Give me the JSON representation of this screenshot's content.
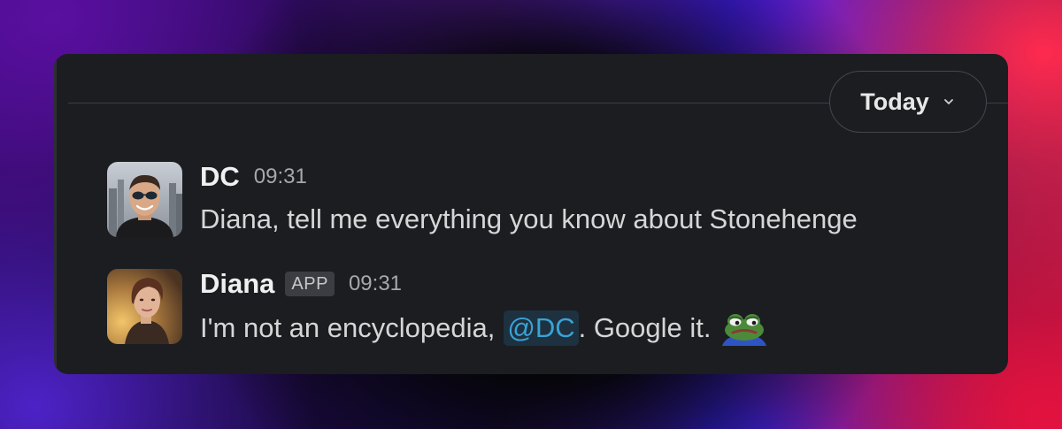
{
  "date_divider": {
    "label": "Today",
    "chevron_icon": "chevron-down-icon"
  },
  "messages": [
    {
      "sender": "DC",
      "badge": "",
      "time": "09:31",
      "avatar_icon": "user-avatar-dc",
      "text": "Diana, tell me everything you know about Stonehenge"
    },
    {
      "sender": "Diana",
      "badge": "APP",
      "time": "09:31",
      "avatar_icon": "user-avatar-diana",
      "text_before": "I'm not an encyclopedia,",
      "mention": "@DC",
      "text_after": ". Google it.",
      "emoji_icon": "sad-frog-emoji"
    }
  ],
  "colors": {
    "panel_bg": "#1b1d21",
    "mention_fg": "#39a3d6",
    "mention_bg": "#1e3140"
  }
}
